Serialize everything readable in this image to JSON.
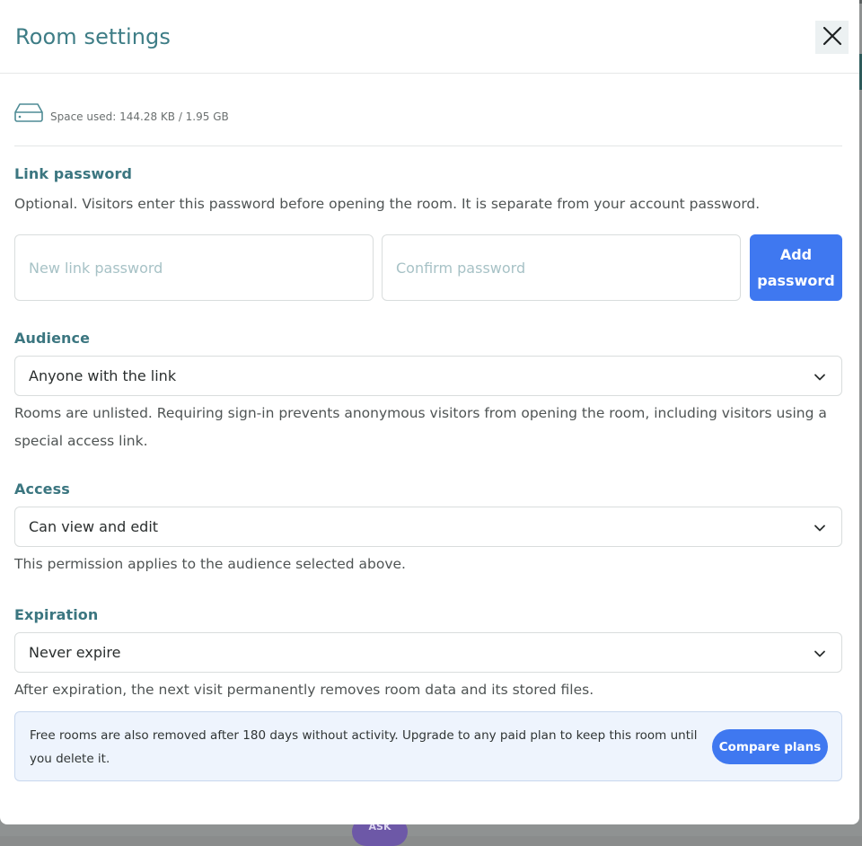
{
  "backdrop": {
    "ask_label": "ASK"
  },
  "dialog": {
    "title": "Room settings"
  },
  "storage": {
    "label": "Space used: 144.28 KB / 1.95 GB"
  },
  "link_password": {
    "label": "Link password",
    "help": "Optional. Visitors enter this password before opening the room. It is separate from your account password.",
    "new_placeholder": "New link password",
    "new_value": "",
    "confirm_placeholder": "Confirm password",
    "confirm_value": "",
    "add_button_line1": "Add",
    "add_button_line2": "password"
  },
  "audience": {
    "label": "Audience",
    "selected": "Anyone with the link",
    "help": "Rooms are unlisted. Requiring sign-in prevents anonymous visitors from opening the room, including visitors using a special access link."
  },
  "access": {
    "label": "Access",
    "selected": "Can view and edit",
    "help": "This permission applies to the audience selected above."
  },
  "expiration": {
    "label": "Expiration",
    "selected": "Never expire",
    "help": "After expiration, the next visit permanently removes room data and its stored files."
  },
  "notice": {
    "text": "Free rooms are also removed after 180 days without activity. Upgrade to any paid plan to keep this room until you delete it.",
    "button": "Compare plans"
  },
  "icons": {
    "close": "close-icon",
    "storage": "hard-drive-icon",
    "dropdown": "chevron-down-icon"
  },
  "colors": {
    "accent": "#3f78f0",
    "title": "#3e7d86",
    "notice_bg": "#eef4fd"
  }
}
